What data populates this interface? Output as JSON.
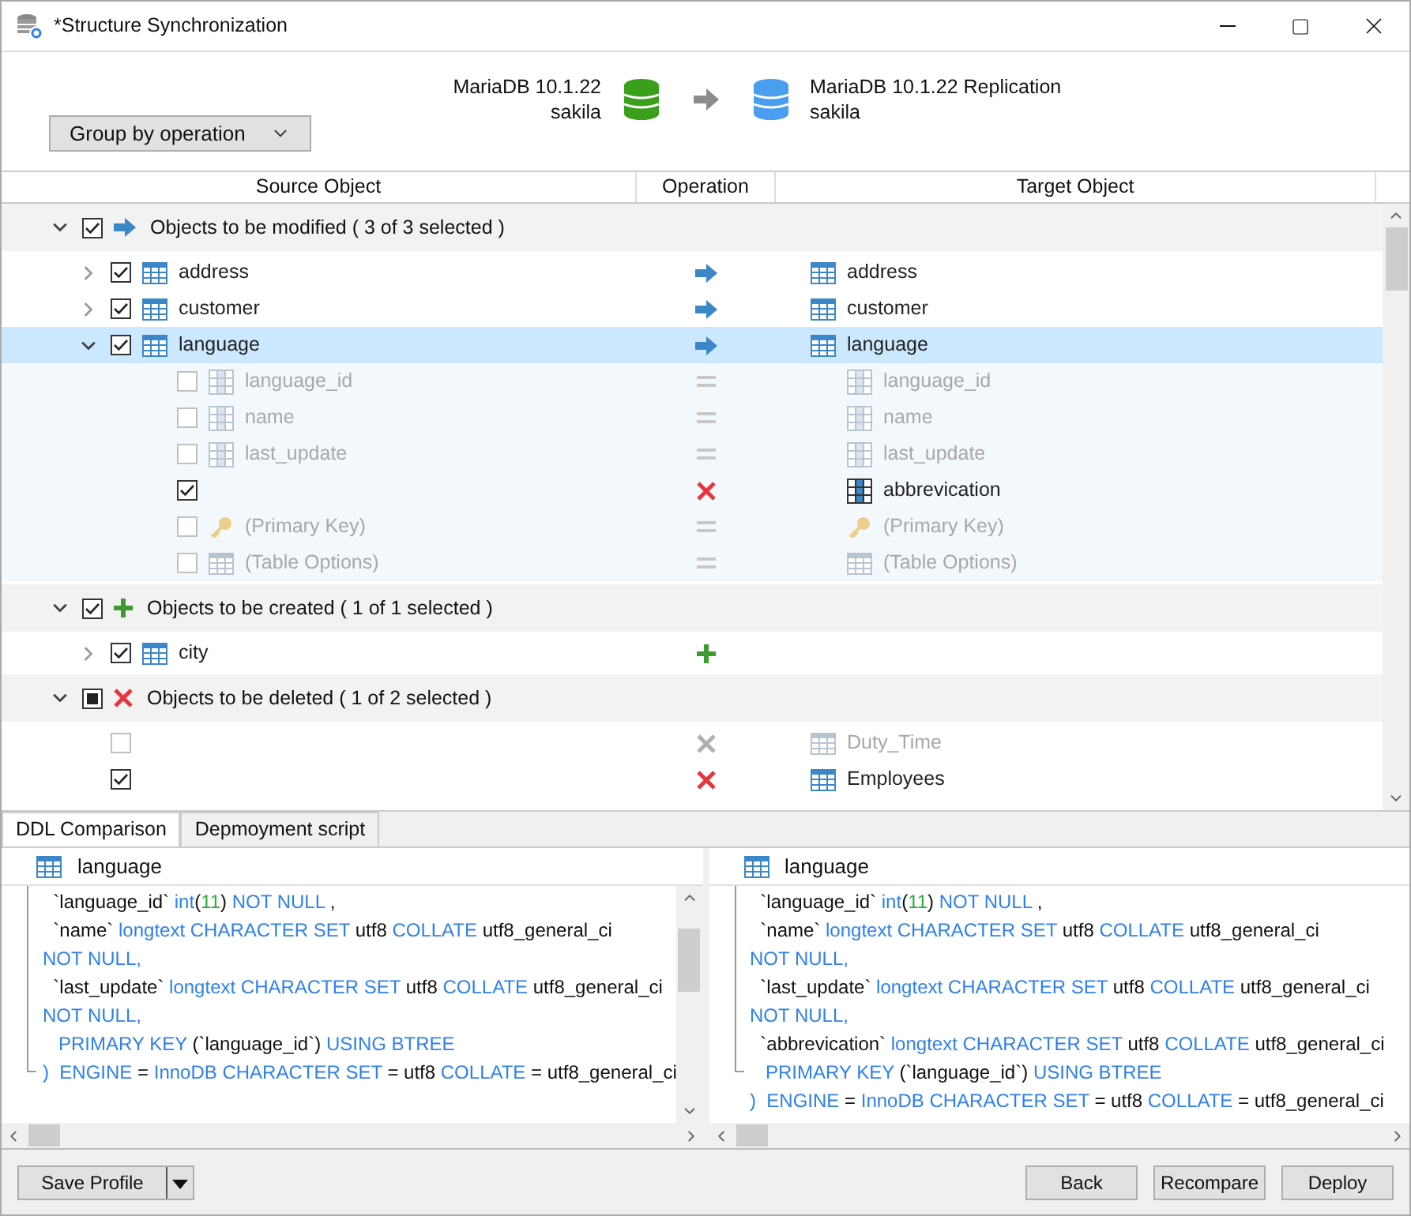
{
  "window": {
    "title": "*Structure Synchronization"
  },
  "source": {
    "server": "MariaDB 10.1.22",
    "database": "sakila"
  },
  "target": {
    "server": "MariaDB 10.1.22 Replication",
    "database": "sakila"
  },
  "group_by": {
    "value": "Group by operation"
  },
  "columns": [
    "Source Object",
    "Operation",
    "Target Object"
  ],
  "groups": [
    {
      "kind": "modify",
      "label": "Objects to be modified ( 3 of 3 selected )",
      "expanded": true,
      "checked": true,
      "indeterminate": false,
      "items": [
        {
          "kind": "update",
          "expanded": false,
          "checked": true,
          "selected": false,
          "dimmed": false,
          "source": {
            "kind": "table",
            "name": "address"
          },
          "target": {
            "kind": "table",
            "name": "address"
          }
        },
        {
          "kind": "update",
          "expanded": false,
          "checked": true,
          "selected": false,
          "dimmed": false,
          "source": {
            "kind": "table",
            "name": "customer"
          },
          "target": {
            "kind": "table",
            "name": "customer"
          }
        },
        {
          "kind": "update",
          "expanded": true,
          "checked": true,
          "selected": true,
          "dimmed": false,
          "source": {
            "kind": "table",
            "name": "language"
          },
          "target": {
            "kind": "table",
            "name": "language"
          },
          "children": [
            {
              "kind": "equal",
              "checked": false,
              "selected": false,
              "dimmed": true,
              "source": {
                "kind": "column",
                "name": "language_id"
              },
              "target": {
                "kind": "column",
                "name": "language_id"
              }
            },
            {
              "kind": "equal",
              "checked": false,
              "selected": false,
              "dimmed": true,
              "source": {
                "kind": "column",
                "name": "name"
              },
              "target": {
                "kind": "column",
                "name": "name"
              }
            },
            {
              "kind": "equal",
              "checked": false,
              "selected": false,
              "dimmed": true,
              "source": {
                "kind": "column",
                "name": "last_update"
              },
              "target": {
                "kind": "column",
                "name": "last_update"
              }
            },
            {
              "kind": "delete",
              "checked": true,
              "selected": false,
              "dimmed": false,
              "target": {
                "kind": "column",
                "name": "abbrevication"
              }
            },
            {
              "kind": "equal",
              "checked": false,
              "selected": false,
              "dimmed": true,
              "source": {
                "kind": "key",
                "name": "(Primary Key)"
              },
              "target": {
                "kind": "key",
                "name": "(Primary Key)"
              }
            },
            {
              "kind": "equal",
              "checked": false,
              "selected": false,
              "dimmed": true,
              "source": {
                "kind": "table",
                "name": "(Table Options)"
              },
              "target": {
                "kind": "table",
                "name": "(Table Options)"
              }
            }
          ]
        }
      ]
    },
    {
      "kind": "create",
      "label": "Objects to be created ( 1 of 1 selected )",
      "expanded": true,
      "checked": true,
      "indeterminate": false,
      "items": [
        {
          "kind": "create",
          "expanded": false,
          "checked": true,
          "selected": false,
          "dimmed": false,
          "source": {
            "kind": "table",
            "name": "city"
          }
        }
      ]
    },
    {
      "kind": "delete",
      "label": "Objects to be deleted ( 1 of 2 selected )",
      "expanded": true,
      "checked": false,
      "indeterminate": true,
      "items": [
        {
          "kind": "delete",
          "checked": false,
          "selected": false,
          "dimmed": true,
          "target": {
            "kind": "table",
            "name": "Duty_Time"
          }
        },
        {
          "kind": "delete",
          "checked": true,
          "selected": false,
          "dimmed": false,
          "target": {
            "kind": "table",
            "name": "Employees"
          }
        }
      ]
    }
  ],
  "tabs": [
    {
      "label": "DDL Comparison",
      "selected": true
    },
    {
      "label": "Depmoyment script",
      "selected": false
    }
  ],
  "ddl": [
    {
      "object": "language",
      "lines": [
        [
          {
            "text": "  `language_id` ",
            "kind": "plain"
          },
          {
            "text": "int",
            "kind": "kw"
          },
          {
            "text": "(",
            "kind": "plain"
          },
          {
            "text": "11",
            "kind": "num"
          },
          {
            "text": ") ",
            "kind": "plain"
          },
          {
            "text": "NOT NULL",
            "kind": "kw"
          },
          {
            "text": " ,",
            "kind": "plain"
          }
        ],
        [
          {
            "text": "  `name` ",
            "kind": "plain"
          },
          {
            "text": "longtext CHARACTER SET",
            "kind": "kw"
          },
          {
            "text": " utf8 ",
            "kind": "plain"
          },
          {
            "text": "COLLATE",
            "kind": "kw"
          },
          {
            "text": " utf8_general_ci",
            "kind": "plain"
          }
        ],
        [
          {
            "text": "NOT NULL,",
            "kind": "kw"
          }
        ],
        [
          {
            "text": "  `last_update` ",
            "kind": "plain"
          },
          {
            "text": "longtext CHARACTER SET",
            "kind": "kw"
          },
          {
            "text": " utf8 ",
            "kind": "plain"
          },
          {
            "text": "COLLATE",
            "kind": "kw"
          },
          {
            "text": " utf8_general_ci",
            "kind": "plain"
          }
        ],
        [
          {
            "text": "NOT NULL,",
            "kind": "kw"
          }
        ],
        [
          {
            "text": "   PRIMARY KEY",
            "kind": "kw"
          },
          {
            "text": " (`language_id`) ",
            "kind": "plain"
          },
          {
            "text": "USING BTREE",
            "kind": "kw"
          }
        ],
        [
          {
            "text": ")  ENGINE",
            "kind": "kw"
          },
          {
            "text": " = ",
            "kind": "plain"
          },
          {
            "text": "InnoDB CHARACTER SET",
            "kind": "kw"
          },
          {
            "text": " = utf8 ",
            "kind": "plain"
          },
          {
            "text": "COLLATE",
            "kind": "kw"
          },
          {
            "text": " = utf8_general_ci",
            "kind": "plain"
          }
        ]
      ]
    },
    {
      "object": "language",
      "lines": [
        [
          {
            "text": "  `language_id` ",
            "kind": "plain"
          },
          {
            "text": "int",
            "kind": "kw"
          },
          {
            "text": "(",
            "kind": "plain"
          },
          {
            "text": "11",
            "kind": "num"
          },
          {
            "text": ") ",
            "kind": "plain"
          },
          {
            "text": "NOT NULL",
            "kind": "kw"
          },
          {
            "text": " ,",
            "kind": "plain"
          }
        ],
        [
          {
            "text": "  `name` ",
            "kind": "plain"
          },
          {
            "text": "longtext CHARACTER SET",
            "kind": "kw"
          },
          {
            "text": " utf8 ",
            "kind": "plain"
          },
          {
            "text": "COLLATE",
            "kind": "kw"
          },
          {
            "text": " utf8_general_ci",
            "kind": "plain"
          }
        ],
        [
          {
            "text": "NOT NULL,",
            "kind": "kw"
          }
        ],
        [
          {
            "text": "  `last_update` ",
            "kind": "plain"
          },
          {
            "text": "longtext CHARACTER SET",
            "kind": "kw"
          },
          {
            "text": " utf8 ",
            "kind": "plain"
          },
          {
            "text": "COLLATE",
            "kind": "kw"
          },
          {
            "text": " utf8_general_ci",
            "kind": "plain"
          }
        ],
        [
          {
            "text": "NOT NULL,",
            "kind": "kw"
          }
        ],
        [
          {
            "text": "  `abbrevication` ",
            "kind": "plain"
          },
          {
            "text": "longtext CHARACTER SET",
            "kind": "kw"
          },
          {
            "text": " utf8 ",
            "kind": "plain"
          },
          {
            "text": "COLLATE",
            "kind": "kw"
          },
          {
            "text": " utf8_general_ci",
            "kind": "plain"
          }
        ],
        [
          {
            "text": "   PRIMARY KEY",
            "kind": "kw"
          },
          {
            "text": " (`language_id`) ",
            "kind": "plain"
          },
          {
            "text": "USING BTREE",
            "kind": "kw"
          }
        ],
        [
          {
            "text": ")  ENGINE",
            "kind": "kw"
          },
          {
            "text": " = ",
            "kind": "plain"
          },
          {
            "text": "InnoDB CHARACTER SET",
            "kind": "kw"
          },
          {
            "text": " = utf8 ",
            "kind": "plain"
          },
          {
            "text": "COLLATE",
            "kind": "kw"
          },
          {
            "text": " = utf8_general_ci",
            "kind": "plain"
          }
        ]
      ]
    }
  ],
  "save_profile": {
    "label": "Save Profile"
  },
  "buttons": [
    "Back",
    "Recompare",
    "Deploy"
  ]
}
